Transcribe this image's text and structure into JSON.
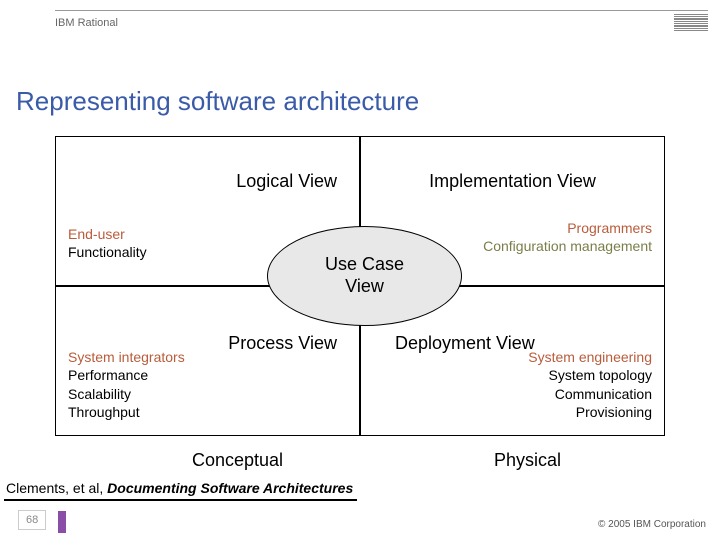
{
  "header": {
    "brand": "IBM Rational"
  },
  "title": "Representing software architecture",
  "views": {
    "tl": {
      "title": "Logical View",
      "role": "End-user",
      "concern1": "Functionality"
    },
    "tr": {
      "title": "Implementation View",
      "role": "Programmers",
      "concern1": "Configuration management"
    },
    "bl": {
      "title": "Process View",
      "role": "System integrators",
      "concern1": "Performance",
      "concern2": "Scalability",
      "concern3": "Throughput"
    },
    "br": {
      "title": "Deployment View",
      "role": "System engineering",
      "concern1": "System topology",
      "concern2": "Communication",
      "concern3": "Provisioning"
    },
    "center": {
      "line1": "Use Case",
      "line2": "View"
    }
  },
  "axis": {
    "left": "Conceptual",
    "right": "Physical"
  },
  "citation": {
    "prefix": "Clements, et al, ",
    "title": "Documenting Software Architectures"
  },
  "footer": {
    "page": "68",
    "copyright": "© 2005 IBM Corporation"
  }
}
